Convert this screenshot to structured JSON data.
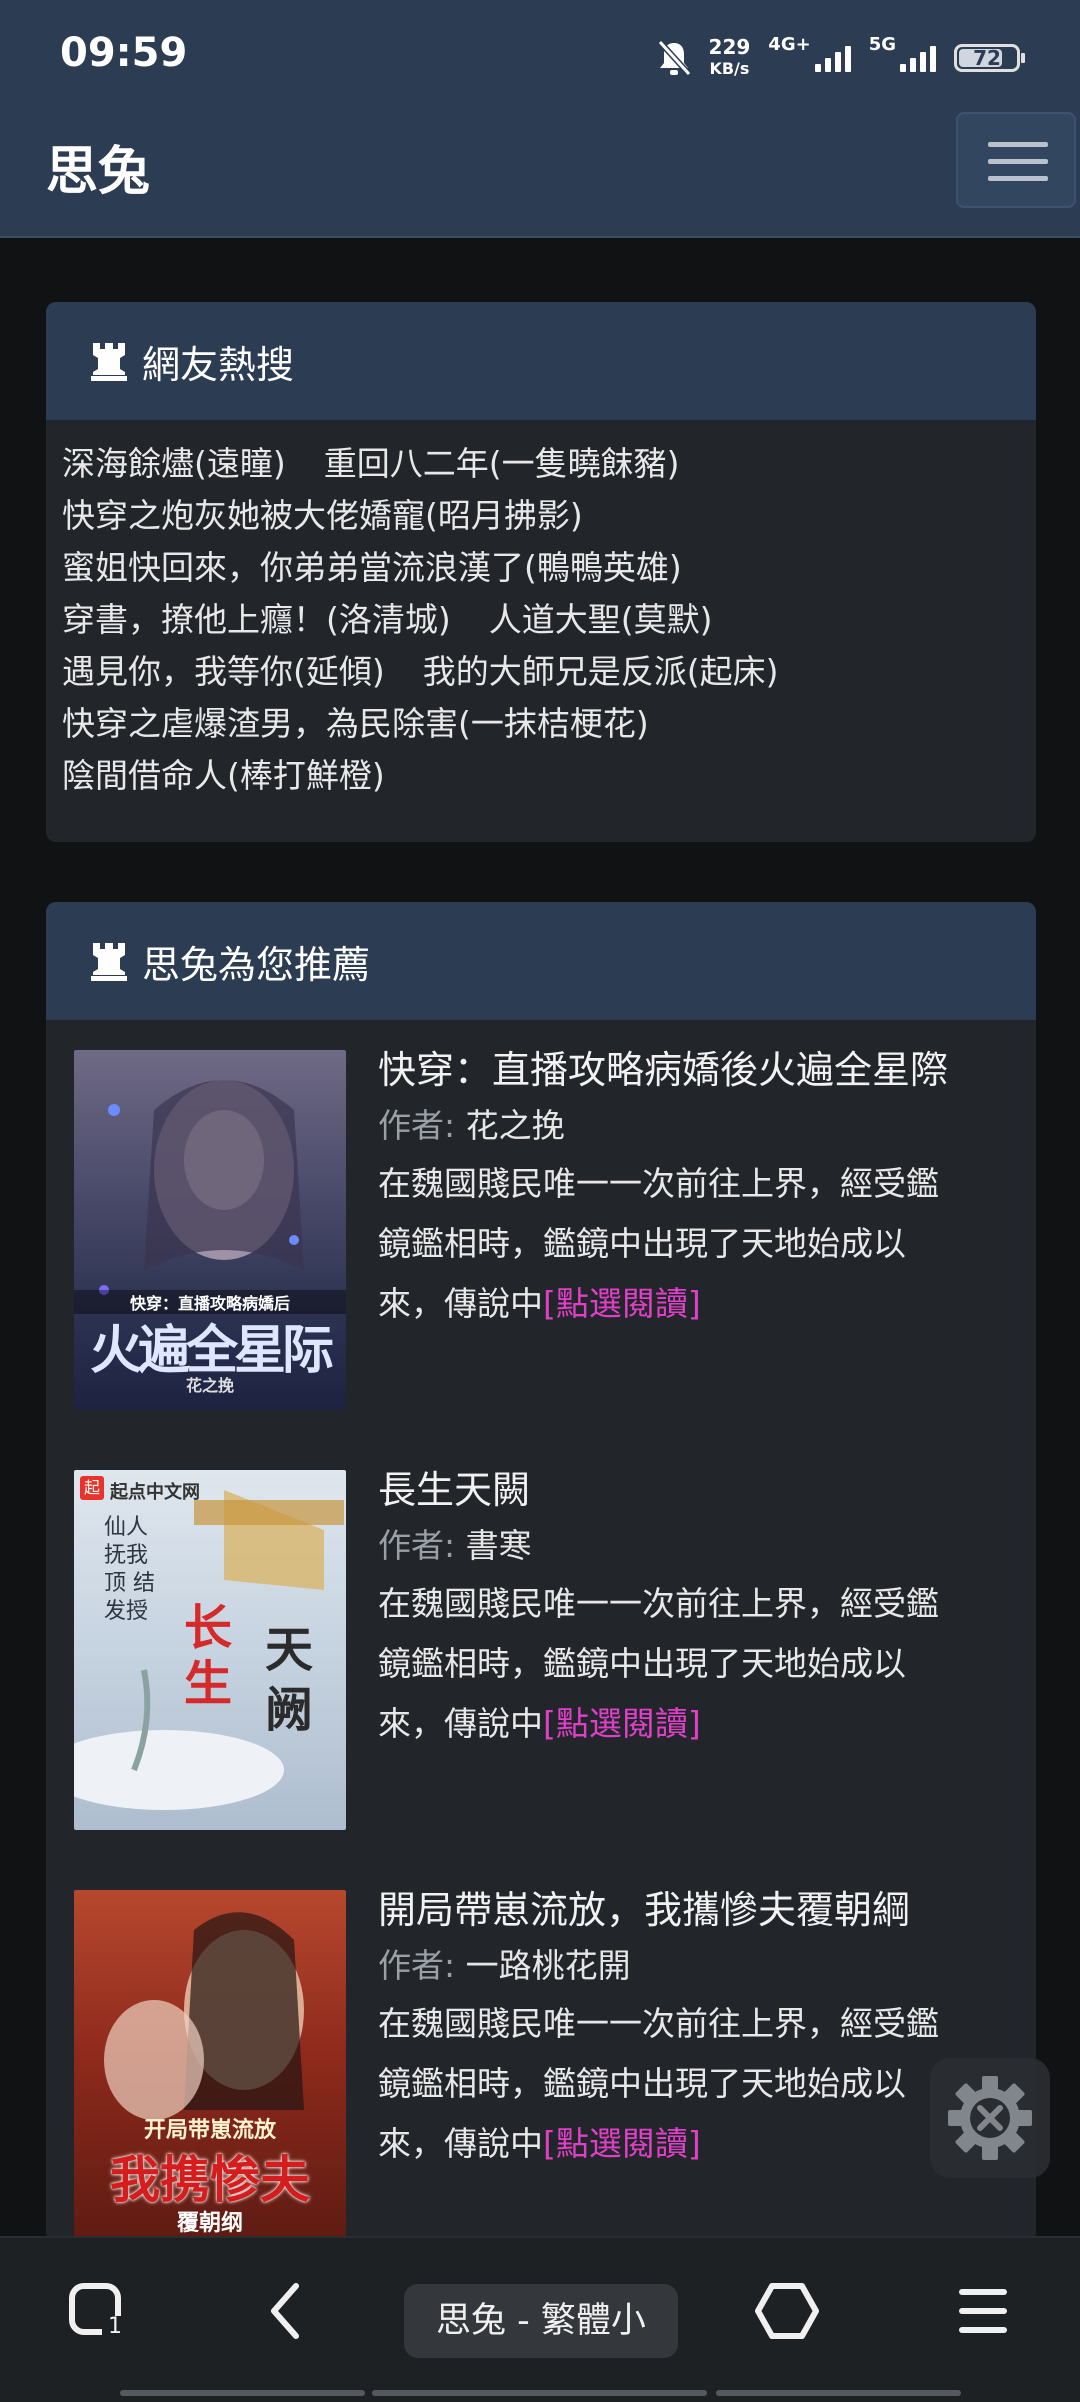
{
  "status_bar": {
    "time": "09:59",
    "speed_value": "229",
    "speed_unit": "KB/s",
    "net1": "4G+",
    "net2": "5G",
    "battery": "72"
  },
  "header": {
    "site_name": "思兔"
  },
  "hot_search": {
    "title": "網友熱搜",
    "lines": [
      [
        "深海餘燼(遠瞳)",
        "重回八二年(一隻曉䬴豬)"
      ],
      [
        "快穿之炮灰她被大佬嬌寵(昭月拂影)"
      ],
      [
        "蜜姐快回來，你弟弟當流浪漢了(鴨鴨英雄)"
      ],
      [
        "穿書，撩他上癮！(洛清城)",
        "人道大聖(莫默)"
      ],
      [
        "遇見你，我等你(延傾)",
        "我的大師兄是反派(起床)"
      ],
      [
        "快穿之虐爆渣男，為民除害(一抹桔梗花)"
      ],
      [
        "陰間借命人(棒打鮮橙)"
      ]
    ]
  },
  "recommend": {
    "title": "思兔為您推薦",
    "author_label": "作者:",
    "read_link": "[點選閱讀]",
    "books": [
      {
        "title": "快穿：直播攻略病嬌後火遍全星際",
        "author": "花之挽",
        "desc_lines": [
          "在魏國賤民唯一一次前往上界，經受鑑",
          "鏡鑑相時，鑑鏡中出現了天地始成以",
          "來，傳說中"
        ],
        "cover_text": "火遍全星际",
        "cover_sub": "快穿：直播攻略病嬌后",
        "cover_author": "花之挽"
      },
      {
        "title": "長生天闕",
        "author": "書寒",
        "desc_lines": [
          "在魏國賤民唯一一次前往上界，經受鑑",
          "鏡鑑相時，鑑鏡中出現了天地始成以",
          "來，傳說中"
        ],
        "cover_text": "长生",
        "cover_text2": "天阙",
        "cover_sub": "仙人抚我顶 结发授",
        "cover_badge": "起",
        "cover_badge_text": "起点中文网"
      },
      {
        "title": "開局帶崽流放，我攜慘夫覆朝綱",
        "author": "一路桃花開",
        "desc_lines": [
          "在魏國賤民唯一一次前往上界，經受鑑",
          "鏡鑑相時，鑑鏡中出現了天地始成以",
          "來，傳說中"
        ],
        "cover_text": "我携惨夫",
        "cover_sub": "开局带崽流放",
        "cover_text2": "覆朝纲"
      }
    ]
  },
  "bottom_nav": {
    "tab_count": "1",
    "url_title": "思兔 - 繁體小"
  },
  "icons": [
    "rook-icon",
    "bell-muted-icon",
    "signal-icon",
    "battery-icon",
    "menu-icon",
    "gear-tools-icon",
    "tabs-icon",
    "back-icon",
    "home-icon",
    "menu-lines-icon"
  ]
}
